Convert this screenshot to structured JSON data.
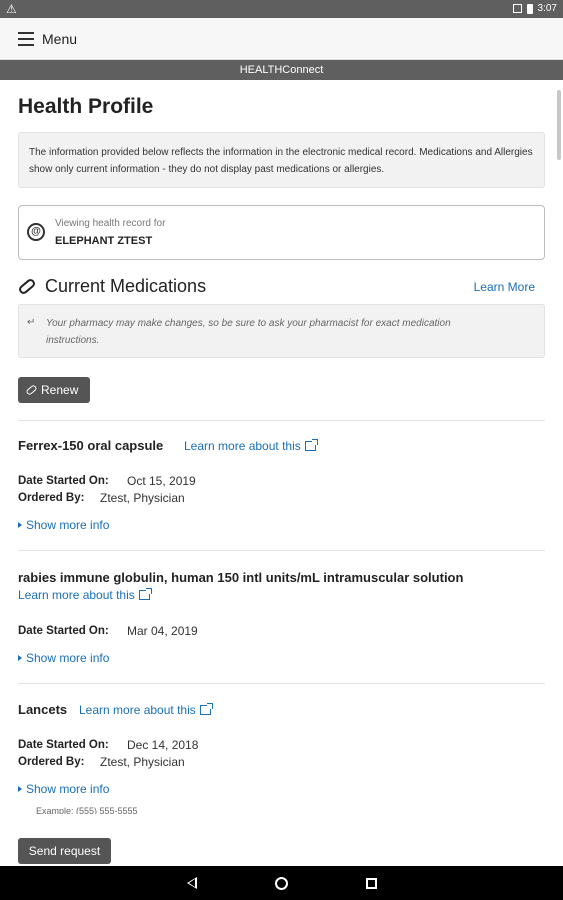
{
  "status_bar": {
    "warning_icon": "warning-triangle-icon",
    "time": "3:07"
  },
  "app_bar": {
    "menu_icon": "hamburger-icon",
    "menu_label": "Menu"
  },
  "brand_bar": {
    "title": "HEALTHConnect"
  },
  "page": {
    "title": "Health Profile",
    "info_text": "The information provided below reflects the information in the electronic medical record. Medications and Allergies show only current information - they do not display past medications or allergies."
  },
  "record": {
    "caption": "Viewing health record for",
    "name": "ELEPHANT ZTEST"
  },
  "medications": {
    "section_title": "Current Medications",
    "learn_more": "Learn More",
    "note": "Your pharmacy may make changes, so be sure to ask your pharmacist for exact medication instructions.",
    "renew_label": "Renew",
    "date_label": "Date Started On:",
    "ordered_label": "Ordered By:",
    "show_more_label": "Show more info",
    "items": [
      {
        "name": "Ferrex-150 oral capsule",
        "link": "Learn more about this",
        "date_started": "Oct 15, 2019",
        "ordered_by": "Ztest, Physician"
      },
      {
        "name": "rabies immune globulin, human 150 intl units/mL intramuscular solution",
        "link": "Learn more about this",
        "date_started": "Mar 04, 2019"
      },
      {
        "name": "Lancets",
        "link": "Learn more about this",
        "date_started": "Dec 14, 2018",
        "ordered_by": "Ztest, Physician"
      }
    ]
  },
  "footer": {
    "example_text": "Example: (555) 555-5555",
    "send_request_label": "Send request"
  },
  "nav_bar": {
    "back_icon": "back-triangle-icon",
    "home_icon": "home-circle-icon",
    "recents_icon": "recents-square-icon"
  }
}
